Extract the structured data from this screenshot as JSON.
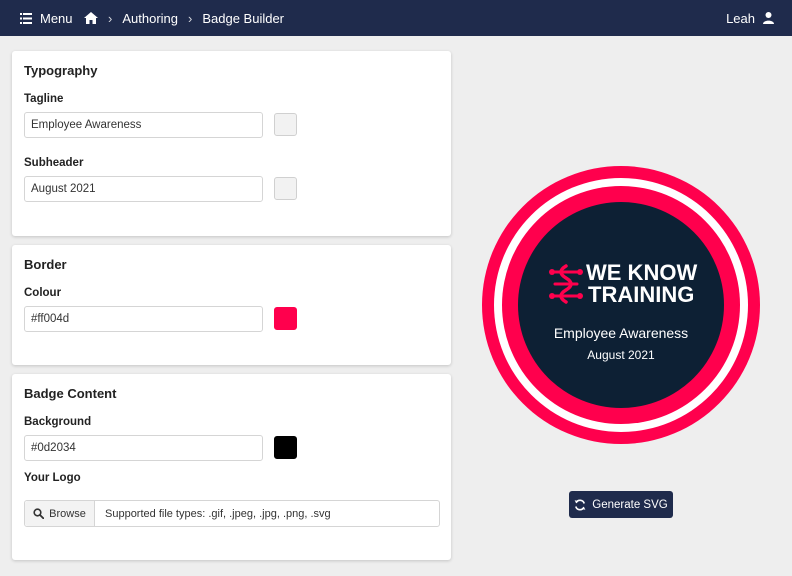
{
  "topbar": {
    "menu_label": "Menu",
    "breadcrumbs": [
      "Authoring",
      "Badge Builder"
    ],
    "user_name": "Leah"
  },
  "typography": {
    "title": "Typography",
    "tagline_label": "Tagline",
    "tagline_value": "Employee Awareness",
    "subheader_label": "Subheader",
    "subheader_value": "August 2021"
  },
  "border": {
    "title": "Border",
    "colour_label": "Colour",
    "colour_value": "#ff004d"
  },
  "badge_content": {
    "title": "Badge Content",
    "background_label": "Background",
    "background_value": "#0d2034",
    "background_swatch": "#000000",
    "logo_label": "Your Logo",
    "browse_label": "Browse",
    "file_types_hint": "Supported file types:  .gif, .jpeg, .jpg, .png, .svg"
  },
  "preview": {
    "brand_line1": "WE KNOW",
    "brand_line2": "TRAINING",
    "tagline": "Employee Awareness",
    "subheader": "August 2021",
    "ring_color": "#ff004d",
    "inner_color": "#0d2034"
  },
  "generate_label": "Generate SVG",
  "colors": {
    "topbar": "#1f2b4c",
    "accent": "#ff004d",
    "swatch_empty": "#f2f2f2"
  }
}
